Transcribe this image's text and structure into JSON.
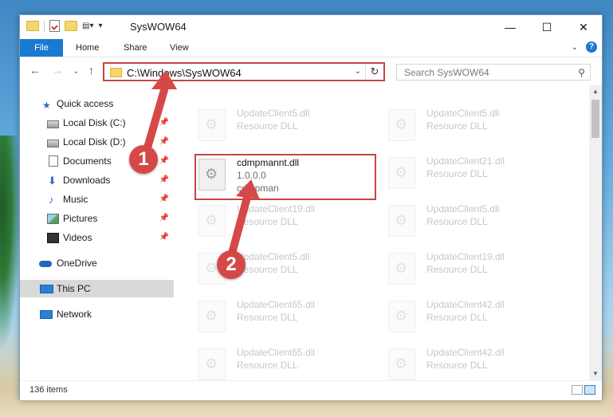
{
  "window": {
    "title": "SysWOW64"
  },
  "ribbon": {
    "tabs": [
      "File",
      "Home",
      "Share",
      "View"
    ],
    "help": "?"
  },
  "navbar": {
    "address": "C:\\Windows\\SysWOW64",
    "search_placeholder": "Search SysWOW64"
  },
  "sidebar": {
    "items": [
      {
        "label": "Quick access",
        "icon": "star-icon"
      },
      {
        "label": "Local Disk (C:)",
        "icon": "disk-icon"
      },
      {
        "label": "Local Disk (D:)",
        "icon": "disk-icon"
      },
      {
        "label": "Documents",
        "icon": "documents-icon"
      },
      {
        "label": "Downloads",
        "icon": "downloads-icon"
      },
      {
        "label": "Music",
        "icon": "music-icon"
      },
      {
        "label": "Pictures",
        "icon": "pictures-icon"
      },
      {
        "label": "Videos",
        "icon": "videos-icon"
      },
      {
        "label": "OneDrive",
        "icon": "onedrive-icon"
      },
      {
        "label": "This PC",
        "icon": "pc-icon"
      },
      {
        "label": "Network",
        "icon": "network-icon"
      }
    ]
  },
  "files": {
    "highlight": {
      "name": "cdmpmannt.dll",
      "version": "1.0.0.0",
      "description": "cdmpman"
    },
    "left": [
      {
        "name": "UpdateClient5.dll",
        "type": "Resource DLL"
      },
      {
        "name": "UpdateClient19.dll",
        "type": "Resource DLL"
      },
      {
        "name": "UpdateClient5.dll",
        "type": "Resource DLL"
      },
      {
        "name": "UpdateClient65.dll",
        "type": "Resource DLL"
      },
      {
        "name": "UpdateClient65.dll",
        "type": "Resource DLL"
      }
    ],
    "right": [
      {
        "name": "UpdateClient5.dll",
        "type": "Resource DLL"
      },
      {
        "name": "UpdateClient21.dll",
        "type": "Resource DLL"
      },
      {
        "name": "UpdateClient5.dll",
        "type": "Resource DLL"
      },
      {
        "name": "UpdateClient19.dll",
        "type": "Resource DLL"
      },
      {
        "name": "UpdateClient42.dll",
        "type": "Resource DLL"
      },
      {
        "name": "UpdateClient42.dll",
        "type": "Resource DLL"
      }
    ]
  },
  "status": {
    "items_count": "136 items"
  },
  "markers": [
    "1",
    "2"
  ],
  "colors": {
    "accent": "#1a79d1",
    "marker": "#d64848",
    "highlight_border": "#c94444"
  }
}
